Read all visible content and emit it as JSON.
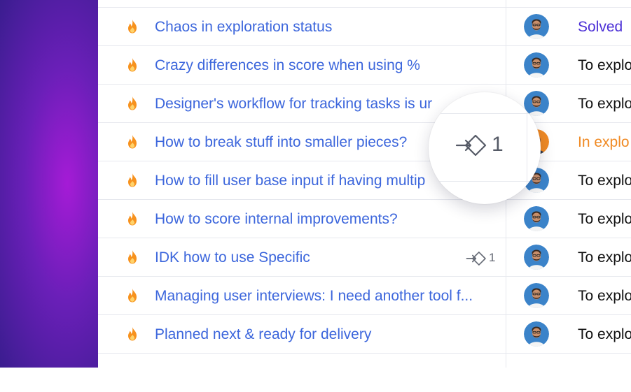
{
  "colors": {
    "link": "#3c66dc",
    "solved": "#4b2fd6",
    "in_exploration": "#f08a24",
    "default_status": "#111111",
    "flame": "#f7921e"
  },
  "zoom": {
    "count": "1",
    "icon": "link-arrow-diamond-icon"
  },
  "rows": [
    {
      "title": "Chaos in exploration status",
      "status": "Solved",
      "status_type": "solved",
      "avatar": "man",
      "link_count": ""
    },
    {
      "title": "Crazy differences in score when using %",
      "status": "To explo",
      "status_type": "default",
      "avatar": "man",
      "link_count": ""
    },
    {
      "title": "Designer's workflow for tracking tasks is ur",
      "status": "To explo",
      "status_type": "default",
      "avatar": "man",
      "link_count": ""
    },
    {
      "title": "How to break stuff into smaller pieces?",
      "status": "In explo",
      "status_type": "in_exploration",
      "avatar": "woman",
      "link_count": ""
    },
    {
      "title": "How to fill user base input if having multip",
      "status": "To explo",
      "status_type": "default",
      "avatar": "man",
      "link_count": ""
    },
    {
      "title": "How to score internal improvements?",
      "status": "To explo",
      "status_type": "default",
      "avatar": "man",
      "link_count": ""
    },
    {
      "title": "IDK how to use Specific",
      "status": "To explo",
      "status_type": "default",
      "avatar": "man",
      "link_count": "1"
    },
    {
      "title": "Managing user interviews: I need another tool f...",
      "status": "To explo",
      "status_type": "default",
      "avatar": "man",
      "link_count": ""
    },
    {
      "title": "Planned next & ready for delivery",
      "status": "To explo",
      "status_type": "default",
      "avatar": "man",
      "link_count": ""
    }
  ]
}
